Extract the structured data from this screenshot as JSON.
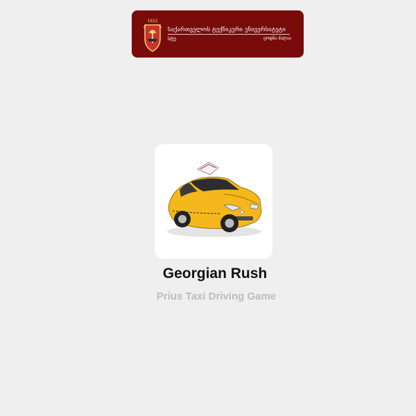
{
  "banner": {
    "university_name": "საქართველოს ტექნიკური უნივერსიტეტი",
    "abbreviation": "სტუ",
    "tagline": "ცოდნა ძალაა",
    "crest_label": "1922",
    "background_color": "#7a0b0b"
  },
  "app": {
    "icon": "yellow-prius-taxi",
    "title": "Georgian Rush",
    "subtitle": "Prius Taxi Driving Game",
    "accent_color": "#f5b81c"
  }
}
